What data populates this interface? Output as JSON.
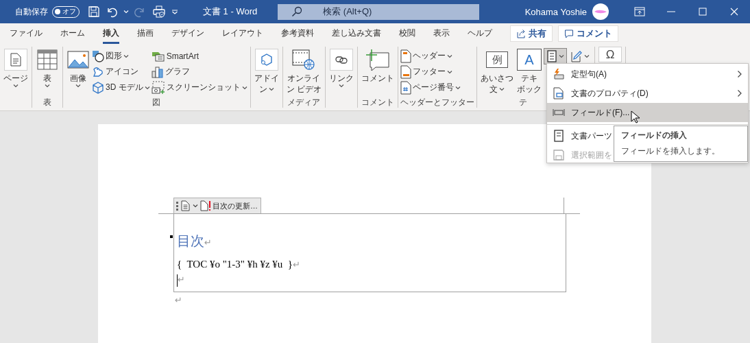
{
  "title_bar": {
    "autosave_label": "自動保存",
    "autosave_toggle": {
      "label": "オフ",
      "on": false
    },
    "redo_disabled": true,
    "title": "文書 1  -  Word",
    "search": {
      "placeholder": "検索 (Alt+Q)"
    },
    "user_name": "Kohama Yoshie"
  },
  "tabs": [
    {
      "label": "ファイル",
      "selected": false
    },
    {
      "label": "ホーム",
      "selected": false
    },
    {
      "label": "挿入",
      "selected": true
    },
    {
      "label": "描画",
      "selected": false
    },
    {
      "label": "デザイン",
      "selected": false
    },
    {
      "label": "レイアウト",
      "selected": false
    },
    {
      "label": "参考資料",
      "selected": false
    },
    {
      "label": "差し込み文書",
      "selected": false
    },
    {
      "label": "校閲",
      "selected": false
    },
    {
      "label": "表示",
      "selected": false
    },
    {
      "label": "ヘルプ",
      "selected": false
    }
  ],
  "share_button": "共有",
  "comment_button": "コメント",
  "ribbon_groups": [
    {
      "items": [
        {
          "kind": "large",
          "lines": [
            "ページ"
          ],
          "caret": true
        }
      ]
    },
    {
      "label": "表",
      "items": [
        {
          "kind": "large",
          "lines": [
            "表"
          ],
          "caret": true
        }
      ]
    },
    {
      "label": "図",
      "items": [
        {
          "kind": "large",
          "lines": [
            "画像"
          ],
          "caret": true
        },
        {
          "kind": "column",
          "items": [
            {
              "label": "図形",
              "caret": true
            },
            {
              "label": "アイコン",
              "caret": false
            },
            {
              "label": "3D モデル",
              "caret": true
            }
          ]
        },
        {
          "kind": "column",
          "items": [
            {
              "label": "SmartArt",
              "caret": false
            },
            {
              "label": "グラフ",
              "caret": false
            },
            {
              "label": "スクリーンショット",
              "caret": true
            }
          ]
        }
      ]
    },
    {
      "items": [
        {
          "kind": "large",
          "lines": [
            "アドイ",
            "ン"
          ],
          "caret": true
        }
      ]
    },
    {
      "label": "メディア",
      "items": [
        {
          "kind": "large",
          "lines": [
            "オンライ",
            "ン ビデオ"
          ],
          "caret": false
        }
      ]
    },
    {
      "items": [
        {
          "kind": "large",
          "lines": [
            "リンク"
          ],
          "caret": true
        }
      ]
    },
    {
      "label": "コメント",
      "items": [
        {
          "kind": "large",
          "lines": [
            "コメント"
          ],
          "caret": false
        }
      ]
    },
    {
      "label": "ヘッダーとフッター",
      "items": [
        {
          "kind": "column",
          "items": [
            {
              "label": "ヘッダー",
              "caret": true
            },
            {
              "label": "フッター",
              "caret": true
            },
            {
              "label": "ページ番号",
              "caret": true
            }
          ]
        }
      ]
    },
    {
      "label": "テ",
      "items": [
        {
          "kind": "large",
          "lines": [
            "あいさつ",
            "文"
          ],
          "caret": true,
          "icon_text": "例"
        },
        {
          "kind": "large",
          "lines": [
            "テキ",
            "ボック"
          ],
          "caret": false,
          "icon_text": "A"
        },
        {
          "kind": "icon",
          "caret": true,
          "pressed": true
        },
        {
          "kind": "icon",
          "caret": true,
          "pressed": false
        }
      ]
    },
    {
      "items": [
        {
          "kind": "large",
          "caret": false,
          "icon_text": "Ω"
        }
      ]
    }
  ],
  "menu": {
    "items": [
      {
        "label": "定型句(A)",
        "submenu": true,
        "selected": false,
        "disabled": false
      },
      {
        "label": "文書のプロパティ(D)",
        "submenu": true,
        "selected": false,
        "disabled": false
      },
      {
        "label": "フィールド(F)...",
        "submenu": false,
        "selected": true,
        "disabled": false
      },
      {
        "label": "文書パーツ",
        "submenu": false,
        "selected": false,
        "disabled": false
      },
      {
        "label": "選択範囲を",
        "submenu": false,
        "selected": false,
        "disabled": true
      }
    ]
  },
  "tooltip": {
    "title": "フィールドの挿入",
    "description": "フィールドを挿入します。"
  },
  "document": {
    "toc_toolbar": {
      "update_button": "目次の更新…"
    },
    "lines": [
      {
        "kind": "heading",
        "text": "目次",
        "mark": "↵"
      },
      {
        "kind": "field",
        "text": "{  TOC ¥o \"1-3\" ¥h ¥z ¥u  }",
        "mark": "↵"
      },
      {
        "kind": "cursor",
        "mark": "↵"
      }
    ],
    "after_mark": "↵"
  }
}
